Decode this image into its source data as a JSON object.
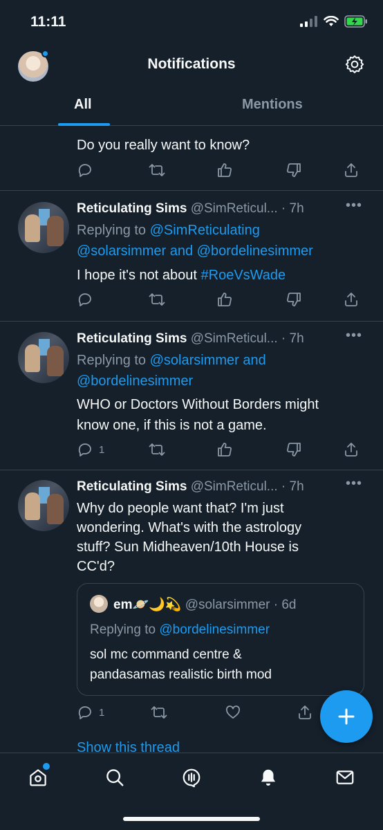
{
  "status": {
    "time": "11:11"
  },
  "header": {
    "title": "Notifications",
    "tabs": [
      "All",
      "Mentions"
    ]
  },
  "feed": {
    "partial": {
      "text": "Do you really want to know?"
    },
    "tweets": [
      {
        "author": "Reticulating Sims",
        "handle": "@SimReticul...",
        "meta": "· 7h",
        "reply_prefix": "Replying to",
        "reply_to_1": "@SimReticulating",
        "reply_to_2": "@solarsimmer and @bordelinesimmer",
        "text": "I hope it's not about",
        "hashtag": "#RoeVsWade",
        "replies": ""
      },
      {
        "author": "Reticulating Sims",
        "handle": "@SimReticul...",
        "meta": "· 7h",
        "reply_prefix": "Replying to",
        "reply_to_1": "@solarsimmer and",
        "reply_to_2": "@bordelinesimmer",
        "text_1": "WHO or Doctors Without Borders might",
        "text_2": "know one, if this is not a game.",
        "replies": "1"
      },
      {
        "author": "Reticulating Sims",
        "handle": "@SimReticul...",
        "meta": "· 7h",
        "text_1": "Why do people want that? I'm just",
        "text_2": "wondering. What's with the astrology",
        "text_3": "stuff? Sun Midheaven/10th House is",
        "text_4": "CC'd?",
        "replies": "1",
        "quote": {
          "author": "em🪐🌙💫",
          "handle": "@solarsimmer",
          "meta": "· 6d",
          "reply_prefix": "Replying to",
          "reply_to": "@bordelinesimmer",
          "text_1": "sol mc command centre &",
          "text_2": "pandasamas realistic birth mod"
        },
        "show_thread": "Show this thread"
      }
    ]
  },
  "icons": {
    "settings": "gear-icon",
    "reply": "reply-icon",
    "retweet": "retweet-icon",
    "upvote": "thumbs-up-icon",
    "downvote": "thumbs-down-icon",
    "share": "share-icon",
    "like": "heart-icon",
    "compose": "plus-icon",
    "nav": [
      "home-icon",
      "search-icon",
      "spaces-icon",
      "bell-icon",
      "mail-icon"
    ]
  },
  "colors": {
    "background": "#15202b",
    "accent": "#1d9bf0",
    "muted": "#8b98a5",
    "divider": "#38444d"
  }
}
